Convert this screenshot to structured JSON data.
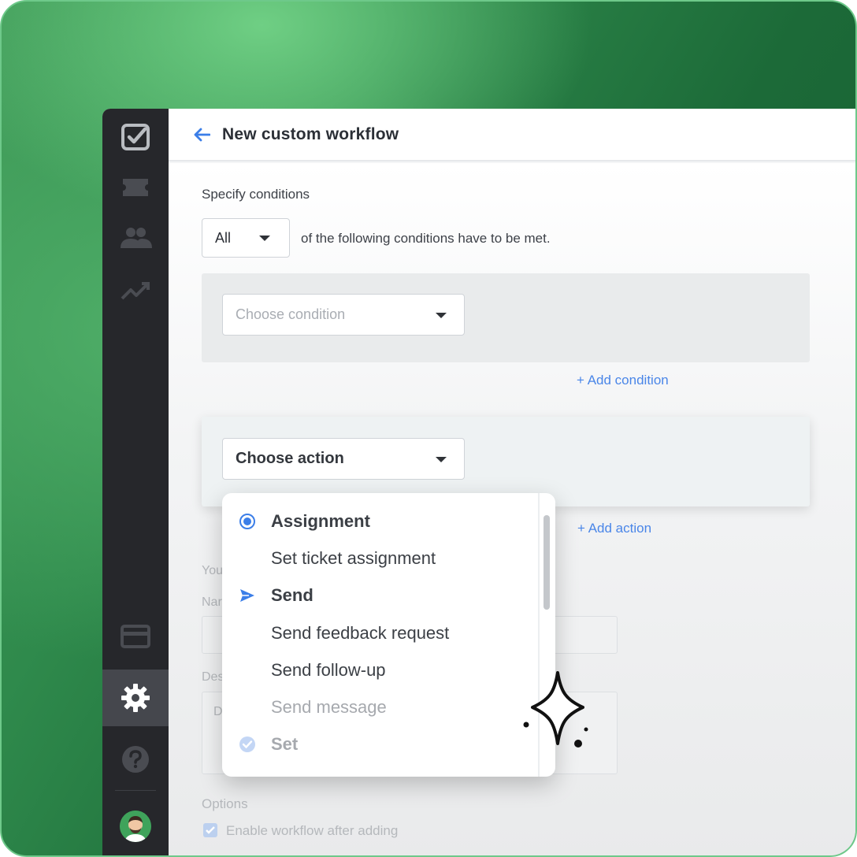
{
  "header": {
    "title": "New custom workflow"
  },
  "conditions": {
    "section_label": "Specify conditions",
    "match_select_value": "All",
    "match_text": "of the following conditions have to be met.",
    "condition_select_placeholder": "Choose condition",
    "add_condition_label": "+ Add condition"
  },
  "actions": {
    "action_select_value": "Choose action",
    "add_action_label": "+ Add action"
  },
  "dropdown": {
    "items": [
      {
        "label": "Assignment",
        "icon": "radio-selected-icon",
        "style": "group"
      },
      {
        "label": "Set ticket assignment",
        "icon": "",
        "style": "option"
      },
      {
        "label": "Send",
        "icon": "send-icon",
        "style": "group"
      },
      {
        "label": "Send feedback request",
        "icon": "",
        "style": "option"
      },
      {
        "label": "Send follow-up",
        "icon": "",
        "style": "option"
      },
      {
        "label": "Send message",
        "icon": "",
        "style": "option-faded"
      },
      {
        "label": "Set",
        "icon": "check-circle-icon",
        "style": "group-faded"
      }
    ]
  },
  "background_form": {
    "your_label": "You",
    "name_label": "Nar",
    "desc_label": "Des",
    "desc_placeholder": "D",
    "options_label": "Options",
    "enable_checkbox_label": "Enable workflow after adding"
  },
  "sidebar": {
    "icons": [
      "tickets-checkbox-icon",
      "inbox-icon",
      "customers-icon",
      "reports-icon",
      "billing-card-icon",
      "settings-gear-icon",
      "help-icon"
    ]
  },
  "colors": {
    "accent": "#4a86e8",
    "sidebar": "#26272b",
    "brand_green": "#2f8a4c"
  }
}
